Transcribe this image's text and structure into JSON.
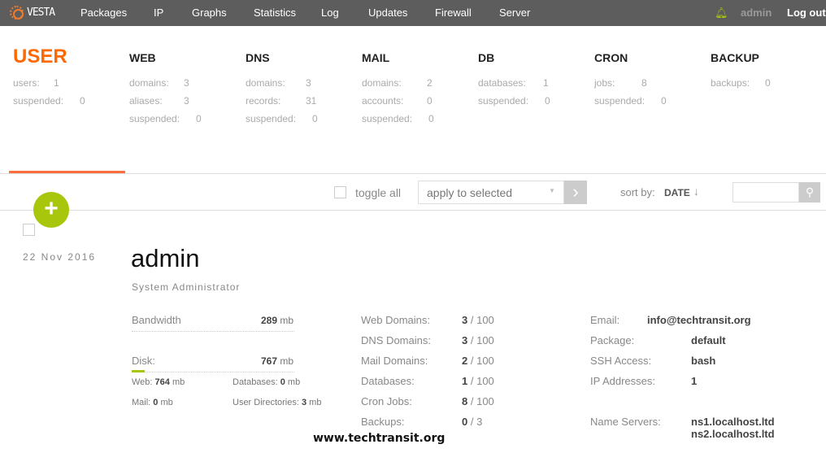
{
  "nav": {
    "logo": "VESTA",
    "items": [
      "Packages",
      "IP",
      "Graphs",
      "Statistics",
      "Log",
      "Updates",
      "Firewall",
      "Server"
    ],
    "user": "admin",
    "logout": "Log out"
  },
  "stats": [
    {
      "title": "USER",
      "rows": [
        [
          "users:",
          "1"
        ],
        [
          "suspended:",
          "0"
        ]
      ]
    },
    {
      "title": "WEB",
      "rows": [
        [
          "domains:",
          "3"
        ],
        [
          "aliases:",
          "3"
        ],
        [
          "suspended:",
          "0"
        ]
      ]
    },
    {
      "title": "DNS",
      "rows": [
        [
          "domains:",
          "3"
        ],
        [
          "records:",
          "31"
        ],
        [
          "suspended:",
          "0"
        ]
      ]
    },
    {
      "title": "MAIL",
      "rows": [
        [
          "domains:",
          "2"
        ],
        [
          "accounts:",
          "0"
        ],
        [
          "suspended:",
          "0"
        ]
      ]
    },
    {
      "title": "DB",
      "rows": [
        [
          "databases:",
          "1"
        ],
        [
          "suspended:",
          "0"
        ]
      ]
    },
    {
      "title": "CRON",
      "rows": [
        [
          "jobs:",
          "8"
        ],
        [
          "suspended:",
          "0"
        ]
      ]
    },
    {
      "title": "BACKUP",
      "rows": [
        [
          "backups:",
          "0"
        ]
      ]
    }
  ],
  "toolbar": {
    "toggle_all": "toggle all",
    "apply": "apply to selected",
    "sort_label": "sort by:",
    "sort_value": "DATE",
    "sort_arrow": "↓",
    "search_placeholder": ""
  },
  "user": {
    "date": "22 Nov 2016",
    "name": "admin",
    "role": "System Administrator",
    "bandwidth_label": "Bandwidth",
    "bandwidth_value": "289",
    "bandwidth_unit": "mb",
    "disk_label": "Disk:",
    "disk_value": "767",
    "disk_unit": "mb",
    "disk_fill_percent": 8,
    "disk_details": [
      [
        "Web:",
        "764",
        "mb"
      ],
      [
        "Databases:",
        "0",
        "mb"
      ],
      [
        "Mail:",
        "0",
        "mb"
      ],
      [
        "User Directories:",
        "3",
        "mb"
      ]
    ],
    "limits": [
      [
        "Web Domains:",
        "3",
        "/ 100"
      ],
      [
        "DNS Domains:",
        "3",
        "/ 100"
      ],
      [
        "Mail Domains:",
        "2",
        "/ 100"
      ],
      [
        "Databases:",
        "1",
        "/ 100"
      ],
      [
        "Cron Jobs:",
        "8",
        "/ 100"
      ],
      [
        "Backups:",
        "0",
        "/ 3"
      ]
    ],
    "email_label": "Email:",
    "email": "info@techtransit.org",
    "info": [
      [
        "Package:",
        "default"
      ],
      [
        "SSH Access:",
        "bash"
      ],
      [
        "IP Addresses:",
        "1"
      ]
    ],
    "ns_label": "Name Servers:",
    "ns": [
      "ns1.localhost.ltd",
      "ns2.localhost.ltd"
    ]
  },
  "watermark": "www.techtransit.org",
  "colors": {
    "accent": "#ff6701",
    "green": "#a8c60c",
    "nav": "#5d5d5d"
  }
}
